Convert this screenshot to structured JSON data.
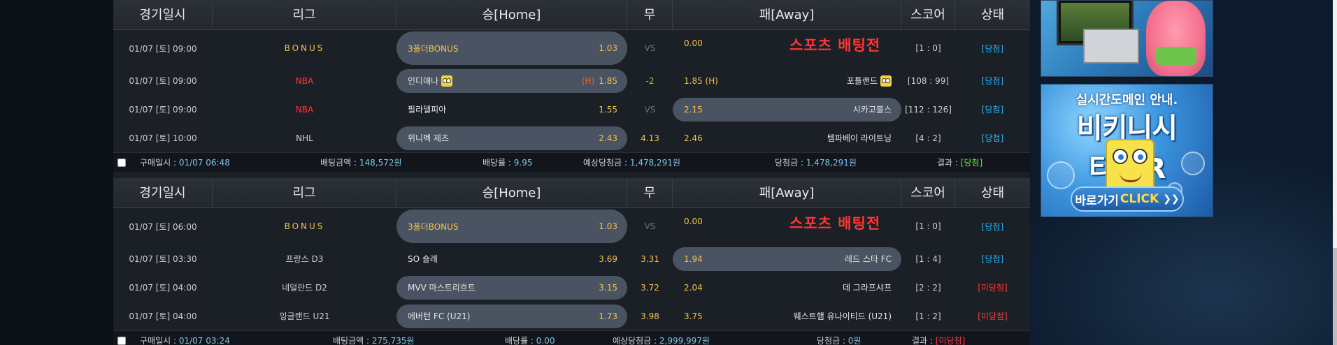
{
  "columns": [
    "경기일시",
    "리그",
    "승[Home]",
    "무",
    "패[Away]",
    "스코어",
    "상태"
  ],
  "sports_bet_label": "스포츠 배팅전",
  "block1": {
    "rows": [
      {
        "date": "01/07 [토] 09:00",
        "league": "BONUS",
        "home": "3폴더BONUS",
        "home_odd": "1.03",
        "draw": "VS",
        "away_odd": "0.00",
        "away": "",
        "score": "[1 : 0]",
        "status": "[당첨]"
      },
      {
        "date": "01/07 [토] 09:00",
        "league": "NBA",
        "home": "인디애나",
        "home_mark": "(H)",
        "home_odd": "1.85",
        "draw": "-2",
        "away_odd": "1.85 (H)",
        "away": "포틀랜드",
        "score": "[108 : 99]",
        "status": "[당첨]"
      },
      {
        "date": "01/07 [토] 09:00",
        "league": "NBA",
        "home": "필라델피아",
        "home_odd": "1.55",
        "draw": "VS",
        "away_odd": "2.15",
        "away": "시카고불스",
        "score": "[112 : 126]",
        "status": "[당첨]"
      },
      {
        "date": "01/07 [토] 10:00",
        "league": "NHL",
        "home": "위니펙 제츠",
        "home_odd": "2.43",
        "draw": "4.13",
        "away_odd": "2.46",
        "away": "템파베이 라이트닝",
        "score": "[4 : 2]",
        "status": "[당첨]"
      }
    ],
    "summary": {
      "buy_label": "구매일시 : ",
      "buy_value": "01/07 06:48",
      "bet_label": "배팅금액 : ",
      "bet_value": "148,572원",
      "rate_label": "배당률 : ",
      "rate_value": "9.95",
      "expect_label": "예상당첨금 : ",
      "expect_value": "1,478,291원",
      "win_label": "당첨금 : ",
      "win_value": "1,478,291원",
      "result_label": "결과 : ",
      "result_value": "[당첨]"
    }
  },
  "block2": {
    "rows": [
      {
        "date": "01/07 [토] 06:00",
        "league": "BONUS",
        "home": "3폴더BONUS",
        "home_odd": "1.03",
        "draw": "VS",
        "away_odd": "0.00",
        "away": "",
        "score": "[1 : 0]",
        "status": "[당첨]"
      },
      {
        "date": "01/07 [토] 03:30",
        "league": "프랑스 D3",
        "home": "SO 숄레",
        "home_odd": "3.69",
        "draw": "3.31",
        "away_odd": "1.94",
        "away": "레드 스타 FC",
        "score": "[1 : 4]",
        "status": "[당첨]"
      },
      {
        "date": "01/07 [토] 04:00",
        "league": "네덜란드 D2",
        "home": "MVV 마스트리흐트",
        "home_odd": "3.15",
        "draw": "3.72",
        "away_odd": "2.04",
        "away": "데 그라프샤프",
        "score": "[2 : 2]",
        "status": "[미당첨]"
      },
      {
        "date": "01/07 [토] 04:00",
        "league": "잉글랜드 U21",
        "home": "에버턴 FC (U21)",
        "home_odd": "1.73",
        "draw": "3.98",
        "away_odd": "3.75",
        "away": "웨스트햄 유나이티드 (U21)",
        "score": "[1 : 2]",
        "status": "[미당첨]"
      }
    ],
    "summary": {
      "buy_label": "구매일시 : ",
      "buy_value": "01/07 03:24",
      "bet_label": "배팅금액 : ",
      "bet_value": "275,735원",
      "rate_label": "배당률 : ",
      "rate_value": "0.00",
      "expect_label": "예상당첨금 : ",
      "expect_value": "2,999,997원",
      "win_label": "당첨금 : ",
      "win_value": "0원",
      "result_label": "결과 : ",
      "result_value": "[미당첨]"
    }
  },
  "banner2": {
    "line1": "실시간도메인 안내.",
    "line2": "비키니시티.KR",
    "button_main": "바로가기",
    "button_click": "CLICK",
    "button_arrow": "❯❯"
  },
  "icons": [
    "sponge-emoji-icon",
    "checkbox-icon"
  ],
  "colors": {
    "odd": "#f2c14e",
    "won": "#29b6f6",
    "lost": "#ff3a3a",
    "sports_bet": "#ff3535"
  }
}
